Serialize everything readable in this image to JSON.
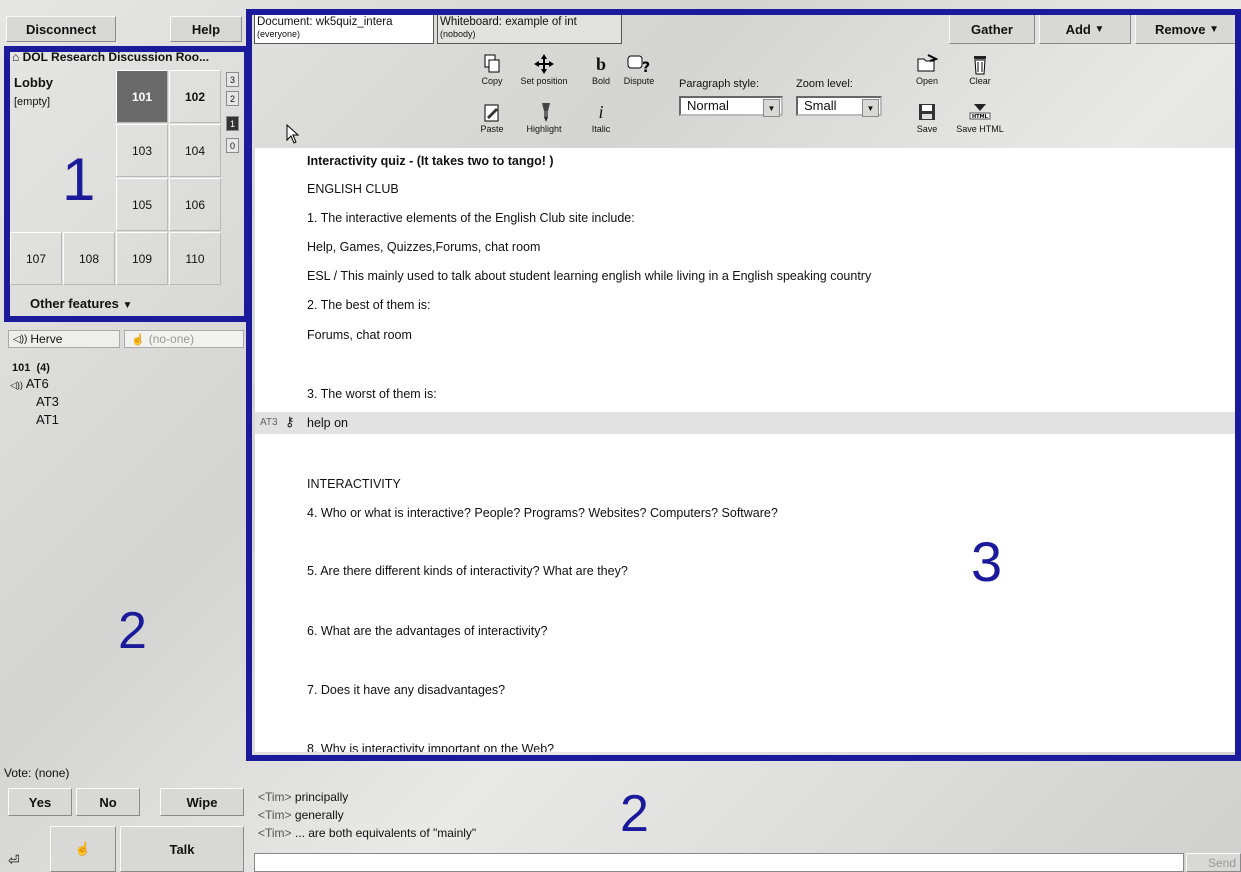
{
  "left": {
    "disconnect": "Disconnect",
    "help": "Help",
    "room_title": "DOL Research Discussion Roo...",
    "lobby": "Lobby",
    "empty": "[empty]",
    "rooms": [
      "101",
      "102",
      "103",
      "104",
      "105",
      "106",
      "107",
      "108",
      "109",
      "110"
    ],
    "floors": [
      "3",
      "2",
      "1",
      "0"
    ],
    "other_features": "Other features",
    "region1": "1"
  },
  "speakers": {
    "speaker": "Herve",
    "hand": "(no-one)",
    "room_label": "101  (4)",
    "users": [
      "AT6",
      "AT3",
      "AT1"
    ],
    "region2": "2"
  },
  "vote": {
    "label": "Vote: (none)",
    "yes": "Yes",
    "no": "No",
    "wipe": "Wipe",
    "talk": "Talk"
  },
  "tabs": {
    "doc_title": "Document: wk5quiz_intera",
    "doc_sub": "(everyone)",
    "wb_title": "Whiteboard: example of int",
    "wb_sub": "(nobody)",
    "gather": "Gather",
    "add": "Add",
    "remove": "Remove"
  },
  "toolbar": {
    "copy": "Copy",
    "paste": "Paste",
    "set_position": "Set position",
    "highlight": "Highlight",
    "bold": "Bold",
    "italic": "Italic",
    "dispute": "Dispute",
    "paragraph_style_label": "Paragraph style:",
    "paragraph_style_value": "Normal",
    "zoom_label": "Zoom level:",
    "zoom_value": "Small",
    "open": "Open",
    "save": "Save",
    "clear": "Clear",
    "save_html": "Save HTML"
  },
  "document": {
    "title": "Interactivity  quiz - (It takes two to tango! )",
    "lines": [
      "ENGLISH CLUB",
      "1. The interactive elements of the English Club site include:",
      "Help, Games, Quizzes,Forums, chat room",
      "ESL / This mainly used to talk about student learning english while living in a English speaking country",
      "2. The best of them is:",
      "Forums, chat room",
      "3. The worst of them is:",
      "help on",
      "INTERACTIVITY",
      "4. Who or what is interactive?  People? Programs? Websites? Computers? Software?",
      "5. Are there different kinds of interactivity? What are they?",
      "6. What are the advantages of interactivity?",
      "7. Does it have any disadvantages?",
      "8. Why is interactivity important on the Web?"
    ],
    "editing_user": "AT3",
    "region3": "3"
  },
  "chat": {
    "messages": [
      {
        "user": "<Tim>",
        "text": "principally"
      },
      {
        "user": "<Tim>",
        "text": "generally"
      },
      {
        "user": "<Tim>",
        "text": "... are both equivalents of \"mainly\""
      }
    ],
    "send": "Send",
    "region2": "2"
  }
}
